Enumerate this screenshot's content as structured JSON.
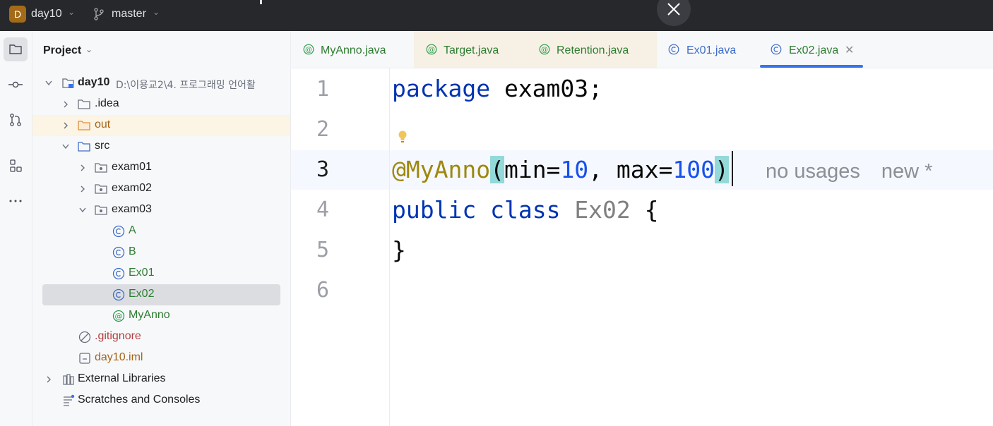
{
  "titlebar": {
    "project_initial": "D",
    "project_name": "day10",
    "branch_name": "master"
  },
  "project_panel": {
    "title": "Project",
    "tree": [
      {
        "label": "day10",
        "path": "D:\\이용교2\\4. 프로그래밍 언어활"
      },
      {
        "label": ".idea"
      },
      {
        "label": "out"
      },
      {
        "label": "src"
      },
      {
        "label": "exam01"
      },
      {
        "label": "exam02"
      },
      {
        "label": "exam03"
      },
      {
        "label": "A"
      },
      {
        "label": "B"
      },
      {
        "label": "Ex01"
      },
      {
        "label": "Ex02"
      },
      {
        "label": "MyAnno"
      },
      {
        "label": ".gitignore"
      },
      {
        "label": "day10.iml"
      },
      {
        "label": "External Libraries"
      },
      {
        "label": "Scratches and Consoles"
      }
    ]
  },
  "editor_tabs": [
    {
      "label": "MyAnno.java",
      "icon": "annotation-icon"
    },
    {
      "label": "Target.java",
      "icon": "annotation-icon"
    },
    {
      "label": "Retention.java",
      "icon": "annotation-icon"
    },
    {
      "label": "Ex01.java",
      "icon": "class-icon"
    },
    {
      "label": "Ex02.java",
      "icon": "class-icon",
      "active": true
    }
  ],
  "editor": {
    "line_numbers": [
      "1",
      "2",
      "3",
      "4",
      "5",
      "6"
    ],
    "current_line": "3",
    "code": {
      "line1_kw": "package",
      "line1_rest": " exam03;",
      "line3_ann": "@MyAnno",
      "line3_open": "(",
      "line3_min": "min=",
      "line3_min_val": "10",
      "line3_sep": ", max=",
      "line3_max_val": "100",
      "line3_close": ")",
      "line4_kw1": "public",
      "line4_kw2": "class",
      "line4_cls": "Ex02",
      "line4_brace": " {",
      "line5": "}"
    },
    "hints": {
      "usages": "no usages",
      "author": "new *"
    }
  },
  "colors": {
    "keyword": "#0033b3",
    "annotation": "#9e880d",
    "number": "#1750eb",
    "accent": "#3574f0"
  }
}
